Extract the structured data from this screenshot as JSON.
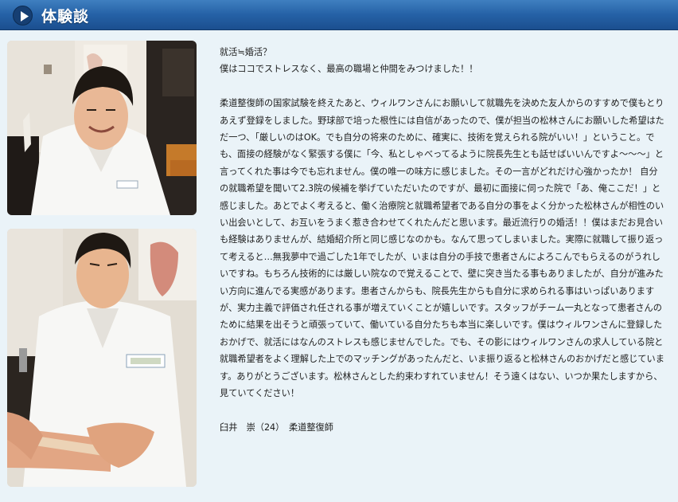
{
  "header": {
    "title": "体験談",
    "icon": "play-icon",
    "color": "#2561a6"
  },
  "photos": [
    {
      "name": "photo-smiling-staff"
    },
    {
      "name": "photo-taping-treatment"
    }
  ],
  "story": {
    "heading_line1": "就活≒婚活？",
    "heading_line2": "僕はココでストレスなく、最高の職場と仲間をみつけました！！",
    "body": "柔道整復師の国家試験を終えたあと、ウィルワンさんにお願いして就職先を決めた友人からのすすめで僕もとりあえず登録をしました。野球部で培った根性には自信があったので、僕が担当の松林さんにお願いした希望はただ一つ、「厳しいのはOK。でも自分の将来のために、確実に、技術を覚えられる院がいい！」ということ。でも、面接の経験がなく緊張する僕に「今、私としゃべってるように院長先生とも話せばいいんですよ～～～」と言ってくれた事は今でも忘れません。僕の唯一の味方に感じました。その一言がどれだけ心強かったか！ 自分の就職希望を聞いて2.3院の候補を挙げていただいたのですが、最初に面接に伺った院で「あ、俺ここだ！」と感じました。あとでよく考えると、働く治療院と就職希望者である自分の事をよく分かった松林さんが相性のいい出会いとして、お互いをうまく惹き合わせてくれたんだと思います。最近流行りの婚活！！僕はまだお見合いも経験はありませんが、結婚紹介所と同じ感じなのかも。なんて思ってしまいました。実際に就職して振り返って考えると…無我夢中で過ごした1年でしたが、いまは自分の手技で患者さんによろこんでもらえるのがうれしいですね。もちろん技術的には厳しい院なので覚えることで、壁に突き当たる事もありましたが、自分が進みたい方向に進んでる実感があります。患者さんからも、院長先生からも自分に求められる事はいっぱいありますが、実力主義で評価され任される事が増えていくことが嬉しいです。スタッフがチーム一丸となって患者さんのために結果を出そうと頑張っていて、働いている自分たちも本当に楽しいです。僕はウィルワンさんに登録したおかげで、就活にはなんのストレスも感じませんでした。でも、その影にはウィルワンさんの求人している院と就職希望者をよく理解した上でのマッチングがあったんだと、いま振り返ると松林さんのおかげだと感じています。ありがとうございます。松林さんとした約束わすれていません！そう遠くはない、いつか果たしますから、見ていてください！",
    "signature": "臼井　崇（24）　柔道整復師"
  }
}
